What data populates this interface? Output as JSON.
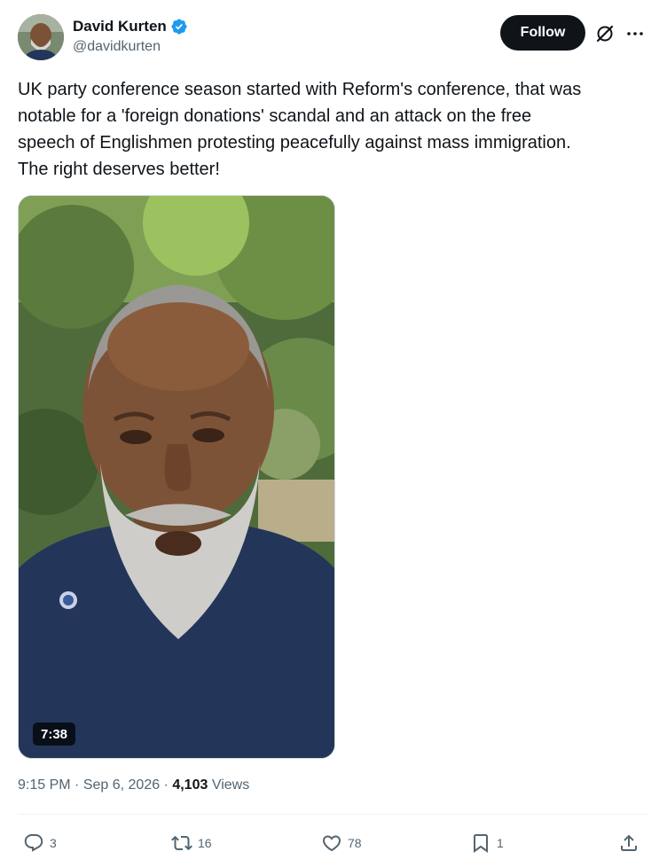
{
  "author": {
    "name": "David Kurten",
    "handle": "@davidkurten",
    "verified": true
  },
  "header": {
    "follow_label": "Follow",
    "grok_icon": "grok-icon",
    "more_icon": "more-icon"
  },
  "tweet": {
    "text": "UK party conference season started with Reform's conference, that was\nnotable for a 'foreign donations' scandal and an attack on the free\nspeech of Englishmen protesting peacefully against mass immigration.\nThe right deserves better!"
  },
  "media": {
    "type": "video",
    "duration": "7:38"
  },
  "meta": {
    "time": "9:15 PM",
    "separator": " · ",
    "date": "Sep 6, 2026",
    "views_count": "4,103",
    "views_label": " Views"
  },
  "actions": {
    "replies": "3",
    "reposts": "16",
    "likes": "78",
    "bookmarks": "1"
  },
  "colors": {
    "text_primary": "#0f1419",
    "text_secondary": "#536471",
    "verified_blue": "#1d9bf0",
    "follow_bg": "#0f1419"
  }
}
